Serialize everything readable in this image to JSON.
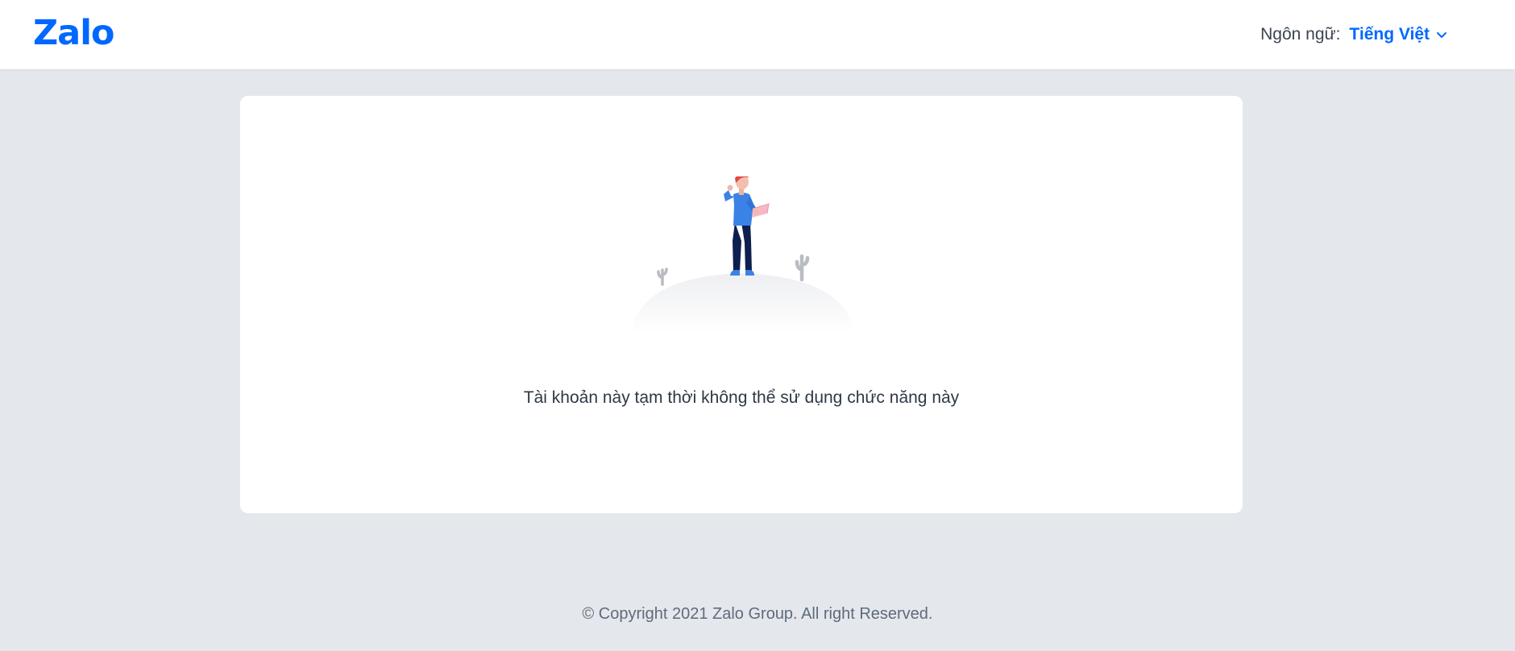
{
  "header": {
    "logo_text": "Zalo",
    "language_label": "Ngôn ngữ:",
    "language_value": "Tiếng Việt"
  },
  "main": {
    "illustration": "lost-person-illustration",
    "message": "Tài khoản này tạm thời không thể sử dụng chức năng này"
  },
  "footer": {
    "copyright": "© Copyright 2021 Zalo Group. All right Reserved."
  },
  "colors": {
    "brand": "#0068ff",
    "background": "#e4e7ec",
    "card": "#ffffff",
    "text": "#2e3846",
    "muted_text": "#5f6b7b"
  }
}
